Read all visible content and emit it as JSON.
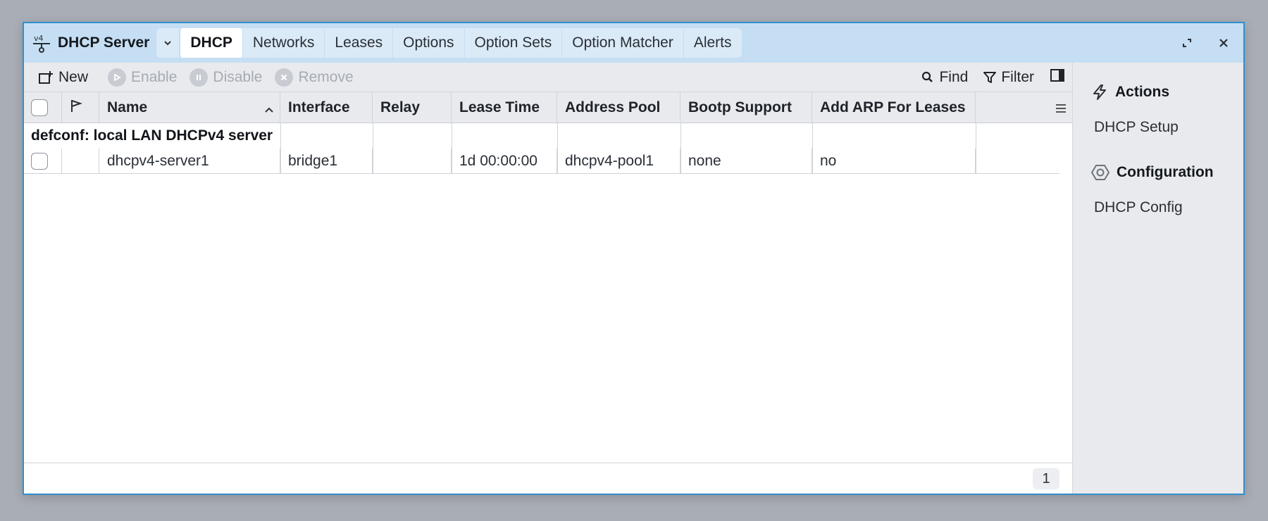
{
  "window": {
    "title": "DHCP Server",
    "icon": "ipv4-network-icon",
    "tabs": [
      {
        "label": "DHCP",
        "active": true
      },
      {
        "label": "Networks",
        "active": false
      },
      {
        "label": "Leases",
        "active": false
      },
      {
        "label": "Options",
        "active": false
      },
      {
        "label": "Option Sets",
        "active": false
      },
      {
        "label": "Option Matcher",
        "active": false
      },
      {
        "label": "Alerts",
        "active": false
      }
    ]
  },
  "toolbar": {
    "new_label": "New",
    "enable_label": "Enable",
    "disable_label": "Disable",
    "remove_label": "Remove",
    "find_label": "Find",
    "filter_label": "Filter"
  },
  "table": {
    "columns": [
      "Name",
      "Interface",
      "Relay",
      "Lease Time",
      "Address Pool",
      "Bootp Support",
      "Add ARP For Leases"
    ],
    "sort_column": "Name",
    "sort_direction": "ascending",
    "group_label": "defconf: local LAN DHCPv4 server",
    "rows": [
      {
        "name": "dhcpv4-server1",
        "interface": "bridge1",
        "relay": "",
        "lease_time": "1d 00:00:00",
        "address_pool": "dhcpv4-pool1",
        "bootp_support": "none",
        "add_arp_for_leases": "no"
      }
    ],
    "row_count": "1"
  },
  "sidepanel": {
    "actions_heading": "Actions",
    "actions_items": [
      "DHCP Setup"
    ],
    "config_heading": "Configuration",
    "config_items": [
      "DHCP Config"
    ]
  },
  "colors": {
    "titlebar": "#c5def3",
    "window_border": "#2f8fd0",
    "toolbar": "#e8eaee"
  }
}
